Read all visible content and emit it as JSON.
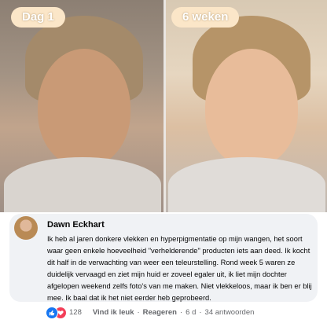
{
  "labels": {
    "before": "Dag 1",
    "after": "6 weken"
  },
  "comment": {
    "author": "Dawn Eckhart",
    "text": "Ik heb al jaren donkere vlekken en hyperpigmentatie op mijn wangen, het soort waar geen enkele hoeveelheid \"verhelderende\" producten iets aan deed. Ik kocht dit half in de verwachting van weer een teleurstelling. Rond week 5 waren ze duidelijk vervaagd en ziet mijn huid er zoveel egaler uit, ik liet mijn dochter afgelopen weekend zelfs foto's van me maken. Niet vlekkeloos, maar ik ben er blij mee. Ik baal dat ik het niet eerder heb geprobeerd."
  },
  "footer": {
    "reaction_count": "128",
    "like_label": "Vind ik leuk",
    "reply_label": "Reageren",
    "age": "6 d",
    "replies": "34 antwoorden",
    "separator": "·"
  },
  "colors": {
    "like": "#1877f2",
    "love": "#f33e58",
    "comment_bg": "#f0f2f5",
    "label_bg": "#fbe6c8"
  },
  "icons": {
    "reactions": [
      "like-icon",
      "love-icon"
    ]
  }
}
